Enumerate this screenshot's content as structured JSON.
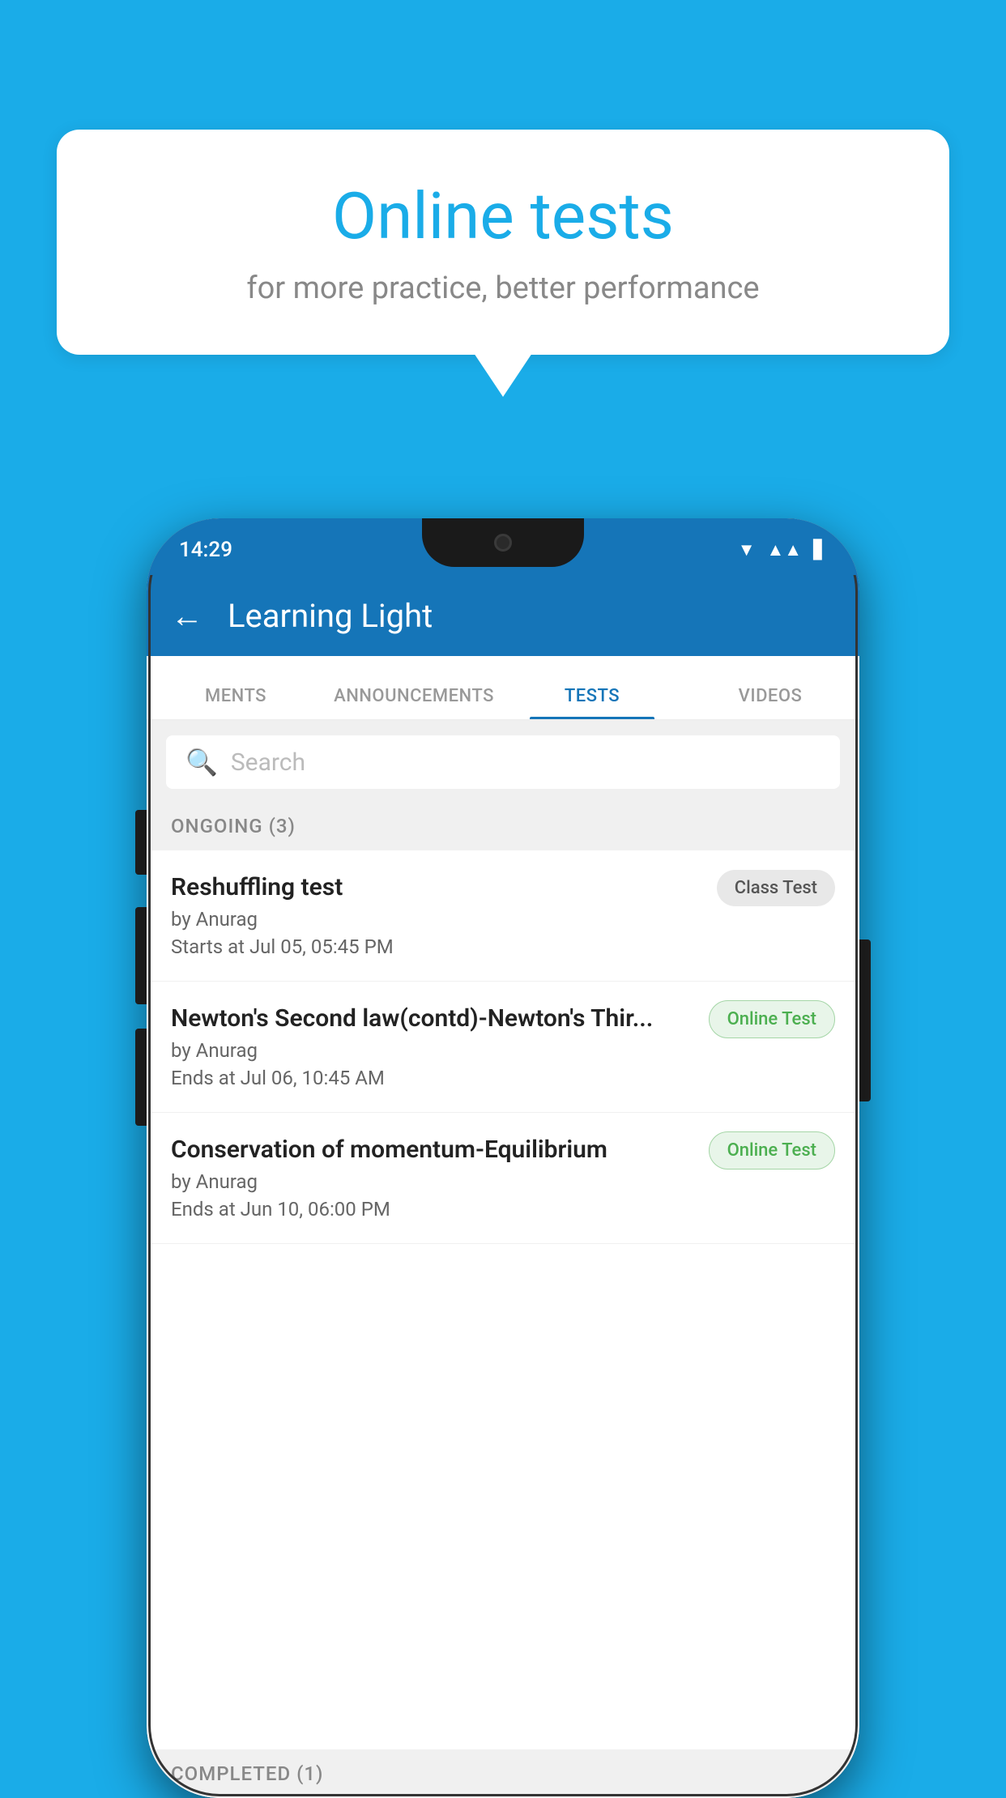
{
  "background": {
    "color": "#1AACE8"
  },
  "speech_bubble": {
    "title": "Online tests",
    "subtitle": "for more practice, better performance"
  },
  "phone": {
    "status_bar": {
      "time": "14:29"
    },
    "app_bar": {
      "title": "Learning Light",
      "back_label": "←"
    },
    "tabs": [
      {
        "label": "MENTS",
        "active": false
      },
      {
        "label": "ANNOUNCEMENTS",
        "active": false
      },
      {
        "label": "TESTS",
        "active": true
      },
      {
        "label": "VIDEOS",
        "active": false
      }
    ],
    "search": {
      "placeholder": "Search"
    },
    "section_ongoing": {
      "label": "ONGOING (3)"
    },
    "test_items": [
      {
        "name": "Reshuffling test",
        "by": "by Anurag",
        "time_label": "Starts at",
        "time": "Jul 05, 05:45 PM",
        "badge": "Class Test",
        "badge_type": "class"
      },
      {
        "name": "Newton's Second law(contd)-Newton's Thir...",
        "by": "by Anurag",
        "time_label": "Ends at",
        "time": "Jul 06, 10:45 AM",
        "badge": "Online Test",
        "badge_type": "online"
      },
      {
        "name": "Conservation of momentum-Equilibrium",
        "by": "by Anurag",
        "time_label": "Ends at",
        "time": "Jun 10, 06:00 PM",
        "badge": "Online Test",
        "badge_type": "online"
      }
    ],
    "section_completed": {
      "label": "COMPLETED (1)"
    }
  }
}
